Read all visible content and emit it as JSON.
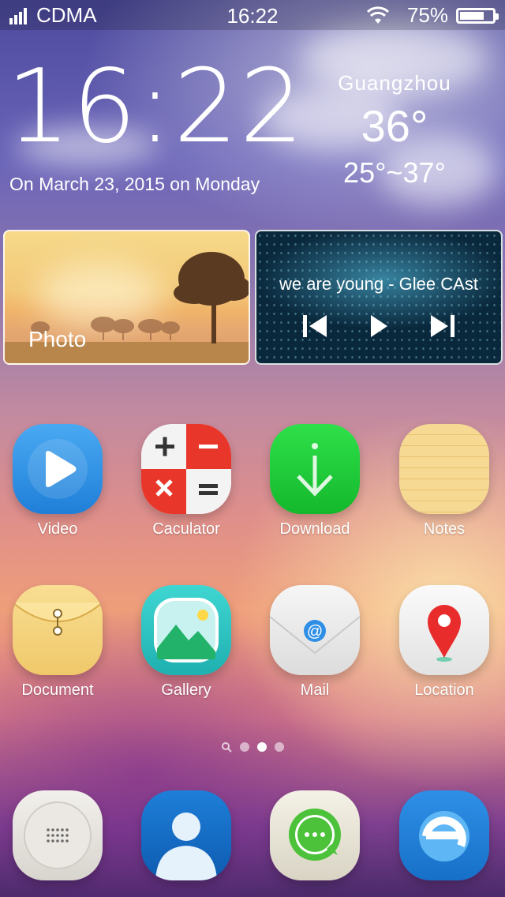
{
  "status_bar": {
    "carrier": "CDMA",
    "time": "16:22",
    "battery": "75%",
    "battery_level": 0.75,
    "icons": [
      "signal-icon",
      "wifi-icon",
      "battery-icon"
    ]
  },
  "clock_widget": {
    "time": "16:22",
    "date": "On March 23, 2015 on Monday"
  },
  "weather_widget": {
    "city": "Guangzhou",
    "temperature": "36°",
    "range": "25°~37°"
  },
  "photo_widget": {
    "label": "Photo"
  },
  "music_widget": {
    "track": "we are young - Glee CAst",
    "controls": [
      "previous-icon",
      "play-icon",
      "next-icon"
    ]
  },
  "apps_row1": [
    {
      "label": "Video",
      "icon": "video-icon"
    },
    {
      "label": "Caculator",
      "icon": "calculator-icon"
    },
    {
      "label": "Download",
      "icon": "download-icon"
    },
    {
      "label": "Notes",
      "icon": "notes-icon"
    }
  ],
  "apps_row2": [
    {
      "label": "Document",
      "icon": "document-icon"
    },
    {
      "label": "Gallery",
      "icon": "gallery-icon"
    },
    {
      "label": "Mail",
      "icon": "mail-icon"
    },
    {
      "label": "Location",
      "icon": "location-icon"
    }
  ],
  "page_indicator": {
    "pages": 3,
    "active": 2,
    "search_page": true
  },
  "dock": [
    {
      "icon": "phone-dialer-icon"
    },
    {
      "icon": "contacts-icon"
    },
    {
      "icon": "messages-icon"
    },
    {
      "icon": "browser-icon"
    }
  ],
  "colors": {
    "video_blue": "#2f8fe6",
    "calc_red": "#e8372a",
    "download_green": "#1fcf3a",
    "notes_yellow": "#f5d58a",
    "gallery_teal": "#2bc8c8",
    "location_red": "#e82b2b",
    "browser_blue": "#2f8fe6"
  }
}
